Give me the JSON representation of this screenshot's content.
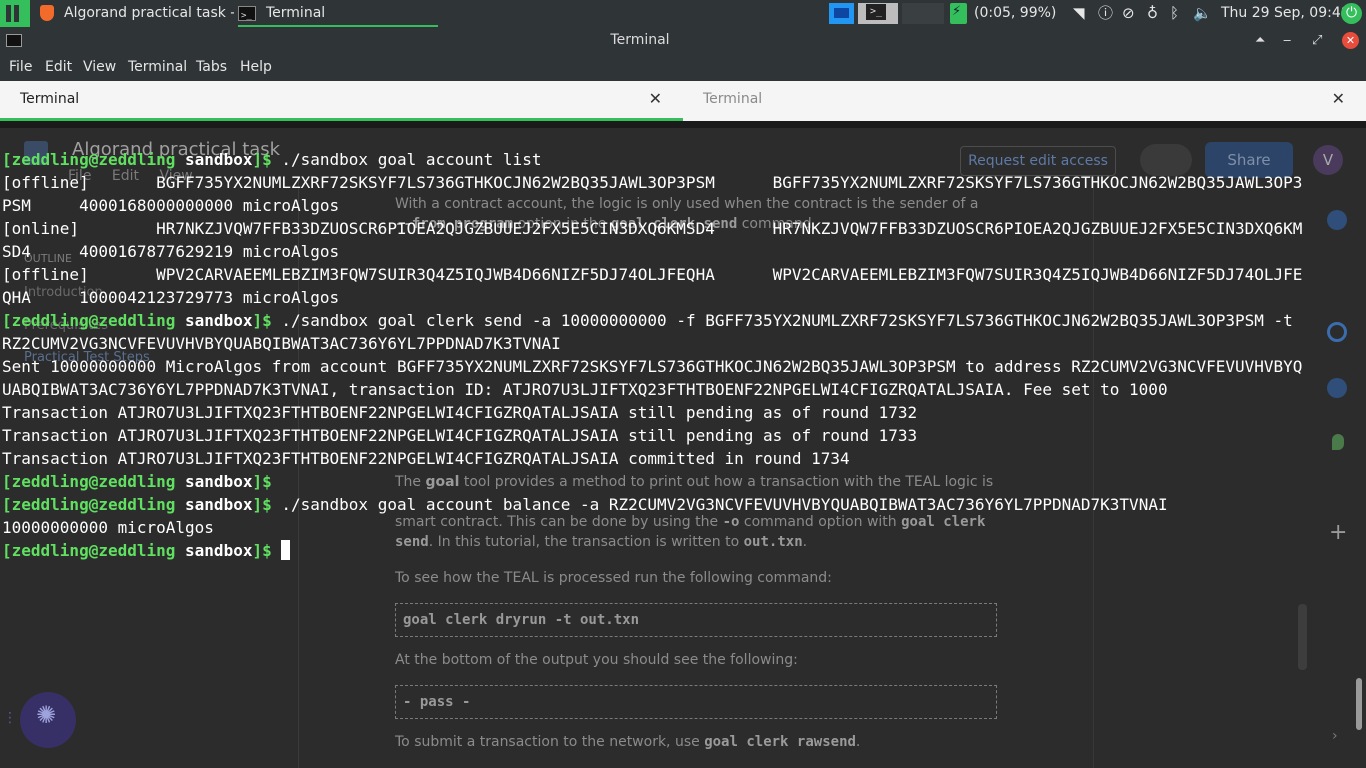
{
  "panel": {
    "tasks": [
      {
        "label": "Algorand practical task - G..."
      },
      {
        "label": "Terminal"
      }
    ],
    "battery": "(0:05, 99%)",
    "clock": "Thu 29 Sep, 09:48"
  },
  "window": {
    "title": "Terminal"
  },
  "menu": [
    "File",
    "Edit",
    "View",
    "Terminal",
    "Tabs",
    "Help"
  ],
  "tabs": [
    {
      "label": "Terminal"
    },
    {
      "label": "Terminal"
    }
  ],
  "terminal": {
    "prompt_user": "[zeddling@zeddling",
    "prompt_dir": "sandbox",
    "prompt_end": "]$",
    "lines": [
      {
        "kind": "prompt",
        "cmd": " ./sandbox goal account list"
      },
      {
        "kind": "out",
        "text": "[offline]\tBGFF735YX2NUMLZXRF72SKSYF7LS736GTHKOCJN62W2BQ35JAWL3OP3PSM\tBGFF735YX2NUMLZXRF72SKSYF7LS736GTHKOCJN62W2BQ35JAWL3OP3"
      },
      {
        "kind": "out",
        "text": "PSM\t4000168000000000 microAlgos"
      },
      {
        "kind": "out",
        "text": "[online]\tHR7NKZJVQW7FFB33DZUOSCR6PIOEA2QJGZBUUEJ2FX5E5CIN3DXQ6KMSD4\tHR7NKZJVQW7FFB33DZUOSCR6PIOEA2QJGZBUUEJ2FX5E5CIN3DXQ6KM"
      },
      {
        "kind": "out",
        "text": "SD4\t4000167877629219 microAlgos"
      },
      {
        "kind": "out",
        "text": "[offline]\tWPV2CARVAEEMLEBZIM3FQW7SUIR3Q4Z5IQJWB4D66NIZF5DJ74OLJFEQHA\tWPV2CARVAEEMLEBZIM3FQW7SUIR3Q4Z5IQJWB4D66NIZF5DJ74OLJFE"
      },
      {
        "kind": "out",
        "text": "QHA\t1000042123729773 microAlgos"
      },
      {
        "kind": "prompt",
        "cmd": " ./sandbox goal clerk send -a 10000000000 -f BGFF735YX2NUMLZXRF72SKSYF7LS736GTHKOCJN62W2BQ35JAWL3OP3PSM -t"
      },
      {
        "kind": "out",
        "text": "RZ2CUMV2VG3NCVFEVUVHVBYQUABQIBWAT3AC736Y6YL7PPDNAD7K3TVNAI"
      },
      {
        "kind": "out",
        "text": "Sent 10000000000 MicroAlgos from account BGFF735YX2NUMLZXRF72SKSYF7LS736GTHKOCJN62W2BQ35JAWL3OP3PSM to address RZ2CUMV2VG3NCVFEVUVHVBYQ"
      },
      {
        "kind": "out",
        "text": "UABQIBWAT3AC736Y6YL7PPDNAD7K3TVNAI, transaction ID: ATJRO7U3LJIFTXQ23FTHTBOENF22NPGELWI4CFIGZRQATALJSAIA. Fee set to 1000"
      },
      {
        "kind": "out",
        "text": "Transaction ATJRO7U3LJIFTXQ23FTHTBOENF22NPGELWI4CFIGZRQATALJSAIA still pending as of round 1732"
      },
      {
        "kind": "out",
        "text": "Transaction ATJRO7U3LJIFTXQ23FTHTBOENF22NPGELWI4CFIGZRQATALJSAIA still pending as of round 1733"
      },
      {
        "kind": "out",
        "text": "Transaction ATJRO7U3LJIFTXQ23FTHTBOENF22NPGELWI4CFIGZRQATALJSAIA committed in round 1734"
      },
      {
        "kind": "prompt",
        "cmd": " "
      },
      {
        "kind": "prompt",
        "cmd": " ./sandbox goal account balance -a RZ2CUMV2VG3NCVFEVUVHVBYQUABQIBWAT3AC736Y6YL7PPDNAD7K3TVNAI"
      },
      {
        "kind": "out",
        "text": "10000000000 microAlgos"
      },
      {
        "kind": "prompt",
        "cmd": " ",
        "cursor": true
      }
    ]
  },
  "background_doc": {
    "title": "Algorand practical task",
    "request_edit": "Request edit access",
    "share": "Share",
    "avatar": "V",
    "menu": "File Edit View",
    "outline": "OUTLINE",
    "outline_items": [
      "Introduction",
      "Prerequisites",
      "Practical Test Steps"
    ],
    "para1_a": "With a contract account, the logic is only used when the contract is the sender of a",
    "para1_b": "option in the",
    "para1_code1": "--from-program",
    "para1_code2": "goal clerk send",
    "para1_c": "command.",
    "para2_a": "The",
    "para2_b": "goal",
    "para2_c": "tool provides a method to print out how a transaction with the TEAL logic is",
    "para2_d": "smart contract. This can be done by using the",
    "para2_e": "-o",
    "para2_f": "command option with",
    "para2_g": "goal clerk",
    "para2_h": "send",
    "para2_i": ". In this tutorial, the transaction is written to",
    "para2_j": "out.txn",
    "para3": "To see how the TEAL is processed run the following command:",
    "code1": "goal clerk dryrun -t out.txn",
    "para4": "At the bottom of the output you should see the following:",
    "code2": "- pass -",
    "para5_a": "To submit a transaction to the network, use",
    "para5_b": "goal clerk rawsend"
  },
  "colors": {
    "accent": "#35bf5c",
    "prompt_user": "#60e060",
    "terminal_bg": "#2c2c2c"
  }
}
